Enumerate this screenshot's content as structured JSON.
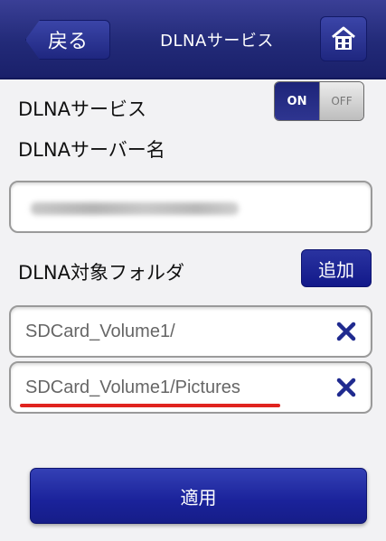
{
  "header": {
    "back_label": "戻る",
    "title": "DLNAサービス"
  },
  "service": {
    "label": "DLNAサービス",
    "toggle_on": "ON",
    "toggle_off": "OFF",
    "state": "on"
  },
  "server_name": {
    "label": "DLNAサーバー名",
    "value": ""
  },
  "folders": {
    "label": "DLNA対象フォルダ",
    "add_label": "追加",
    "items": [
      {
        "path": "SDCard_Volume1/"
      },
      {
        "path": "SDCard_Volume1/Pictures"
      }
    ]
  },
  "apply_label": "適用",
  "colors": {
    "navy": "#222a78",
    "delete_x": "#1f2a8f",
    "highlight_underline": "#e0231f"
  },
  "icons": [
    "home-icon",
    "close-icon"
  ]
}
